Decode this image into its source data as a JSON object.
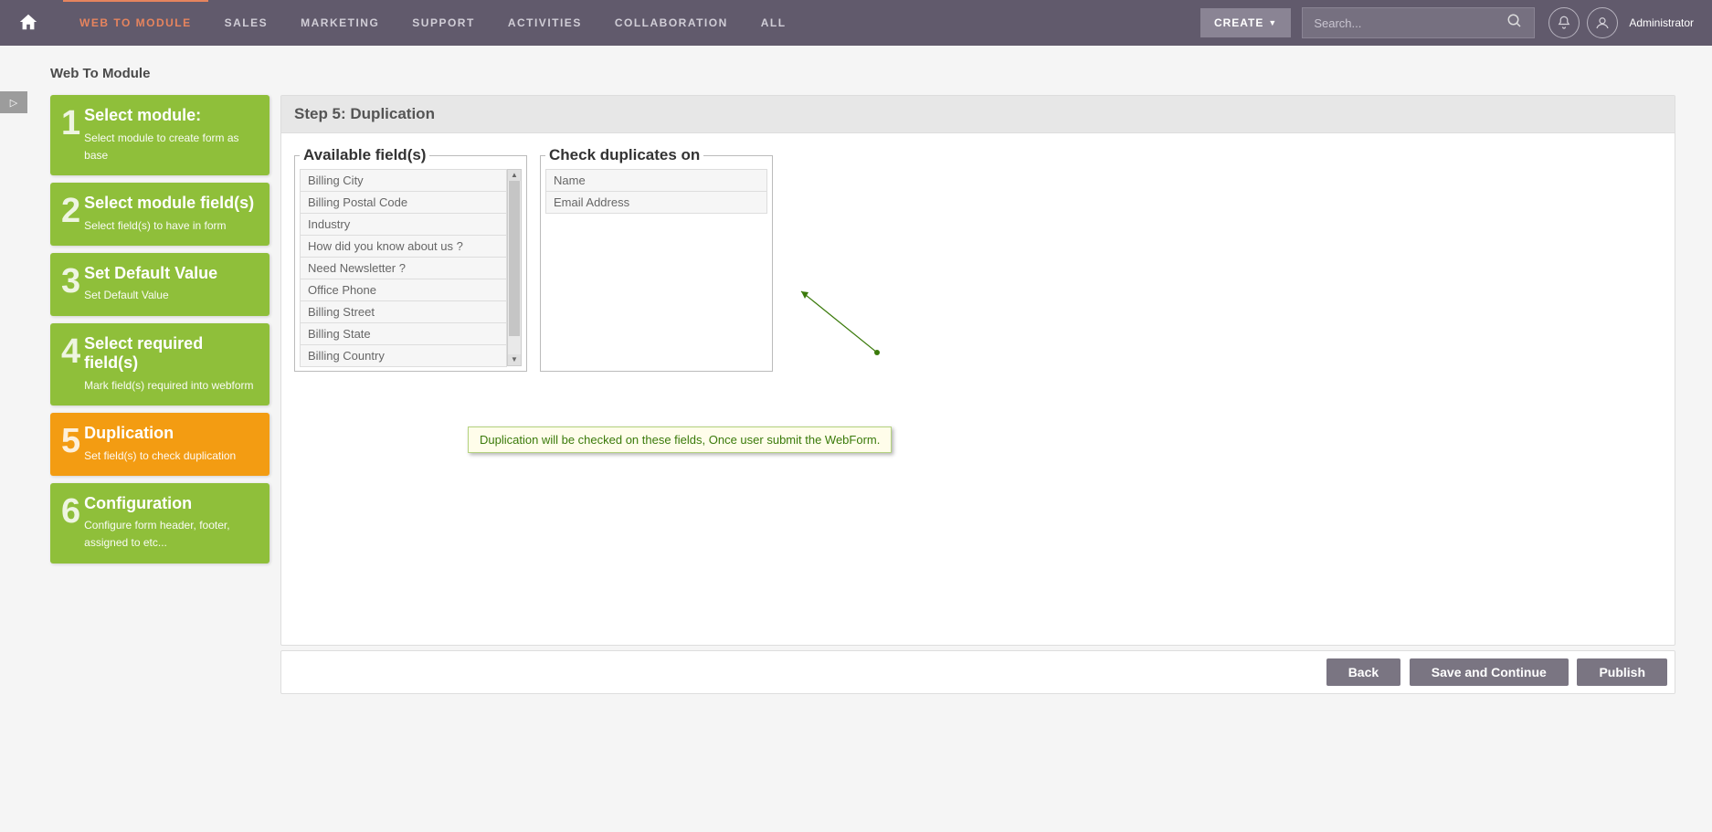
{
  "topnav": {
    "items": [
      "WEB TO MODULE",
      "SALES",
      "MARKETING",
      "SUPPORT",
      "ACTIVITIES",
      "COLLABORATION",
      "ALL"
    ],
    "create_label": "CREATE",
    "search_placeholder": "Search...",
    "admin_name": "Administrator"
  },
  "breadcrumb": "Web To Module",
  "steps": [
    {
      "num": "1",
      "title": "Select module:",
      "desc": "Select module to create form as base"
    },
    {
      "num": "2",
      "title": "Select module field(s)",
      "desc": "Select field(s) to have in form"
    },
    {
      "num": "3",
      "title": "Set Default Value",
      "desc": "Set Default Value"
    },
    {
      "num": "4",
      "title": "Select required field(s)",
      "desc": "Mark field(s) required into webform"
    },
    {
      "num": "5",
      "title": "Duplication",
      "desc": "Set field(s) to check duplication"
    },
    {
      "num": "6",
      "title": "Configuration",
      "desc": "Configure form header, footer, assigned to etc..."
    }
  ],
  "active_step_index": 4,
  "panel": {
    "title": "Step 5: Duplication",
    "avail_legend": "Available field(s)",
    "check_legend": "Check duplicates on",
    "available_fields": [
      "Billing City",
      "Billing Postal Code",
      "Industry",
      "How did you know about us ?",
      "Need Newsletter ?",
      "Office Phone",
      "Billing Street",
      "Billing State",
      "Billing Country"
    ],
    "check_fields": [
      "Name",
      "Email Address"
    ],
    "callout_text": "Duplication will be checked on these fields, Once user submit the WebForm."
  },
  "footer": {
    "back": "Back",
    "save": "Save and Continue",
    "publish": "Publish"
  }
}
